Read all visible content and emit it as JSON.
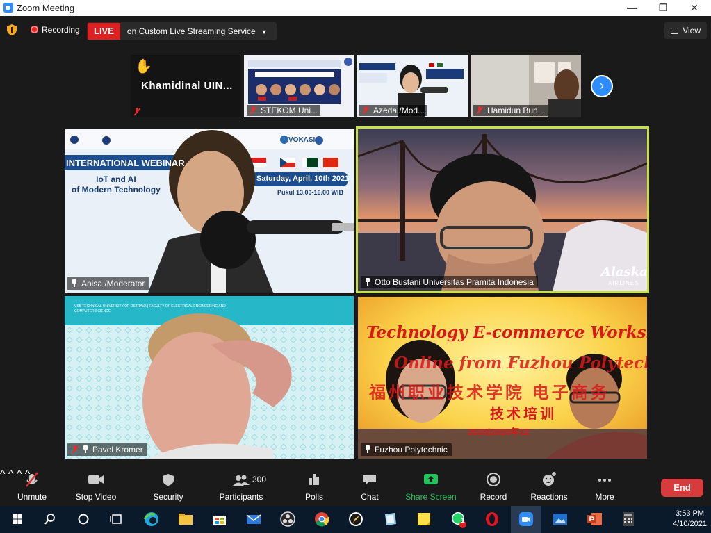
{
  "window": {
    "title": "Zoom Meeting",
    "minimize": "—",
    "restore": "❐",
    "close": "✕"
  },
  "topbar": {
    "recording": "Recording",
    "live_badge": "LIVE",
    "live_service": "on Custom Live Streaming Service",
    "view_label": "View"
  },
  "strip": {
    "raise_hand_icon": "✋",
    "items": [
      {
        "name": "Khamidinal UIN..."
      },
      {
        "name": "STEKOM Uni..."
      },
      {
        "name": "Azeda /Mod..."
      },
      {
        "name": "Hamidun Bun..."
      }
    ],
    "next_icon": "›"
  },
  "tiles": [
    {
      "name": "Anisa /Moderator"
    },
    {
      "name": "Otto Bustani Universitas Pramita Indonesia"
    },
    {
      "name": "Pavel Kromer"
    },
    {
      "name": "Fuzhou Polytechnic"
    }
  ],
  "slides": {
    "webinar_heading": "INTERNATIONAL WEBINAR",
    "webinar_subtitle": "IoT and AI\nof Modern Technology",
    "date": "Saturday, April, 10th 2021",
    "time": "Pukul 13.00-16.00 WIB",
    "vokasi": "VOKASI",
    "banner_line1": "Technology E-commerce Workshop",
    "banner_line2": "Online from Fuzhou Polytechnic",
    "banner_cn": "福州职业技术学院 电子商务",
    "banner_cn2": "技术培训",
    "banner_date": "2020|2020年12",
    "alaska": "Alaska",
    "airlines": "AIRLINES",
    "vsb_text": "VSB TECHNICAL UNIVERSITY OF OSTRAVA | FACULTY OF ELECTRICAL ENGINEERING AND COMPUTER SCIENCE"
  },
  "toolbar": {
    "unmute": "Unmute",
    "stop_video": "Stop Video",
    "security": "Security",
    "participants": "Participants",
    "participants_count": "300",
    "polls": "Polls",
    "chat": "Chat",
    "share_screen": "Share Screen",
    "record": "Record",
    "reactions": "Reactions",
    "more": "More",
    "end": "End"
  },
  "taskbar": {
    "time": "3:53 PM",
    "date": "4/10/2021",
    "whatsapp_badge": "1"
  },
  "colors": {
    "accent": "#2d8cff",
    "live_red": "#e02020",
    "share_green": "#21c35b",
    "active_speaker_border": "#c7e04a",
    "end_red": "#d83b3b"
  }
}
